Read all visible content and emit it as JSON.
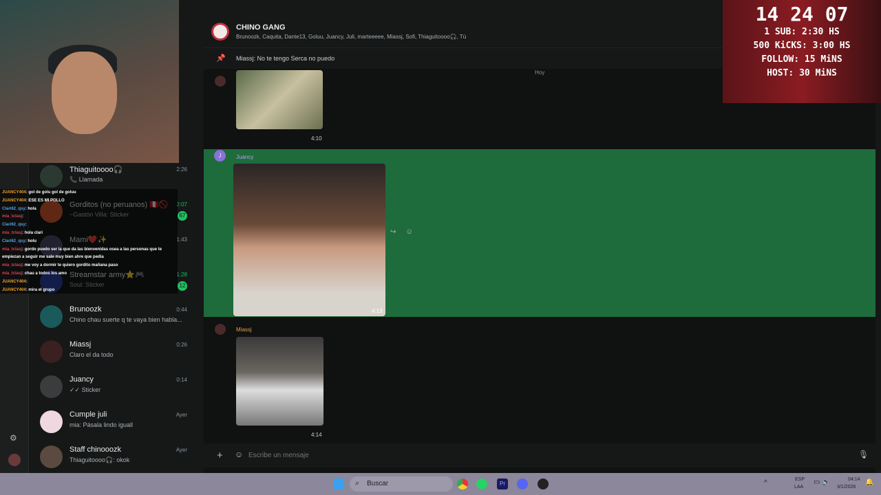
{
  "chat": {
    "name": "CHINO GANG",
    "members": "Brunoozk, Caquita, Dante13, Goluu, Juancy, Juli, marteeeee, Miassj, Sofi, Thiaguitoooo🎧, Tú",
    "pinned": "Miassj: No te tengo Serca no puedo",
    "day": "Hoy",
    "input_placeholder": "Escribe un mensaje"
  },
  "messages": [
    {
      "sender": "",
      "time": "4:10"
    },
    {
      "sender": "Juancy",
      "time": "4:13"
    },
    {
      "sender": "Miassj",
      "time": "4:14"
    }
  ],
  "chats": [
    {
      "name": "Thiaguitoooo🎧",
      "time": "2:26",
      "preview": "📞 Llamada"
    },
    {
      "name": "Gorditos (no peruanos) 🇵🇪🚫",
      "time": "2:07",
      "preview": "~Gastón Villa: Sticker",
      "badge": "67"
    },
    {
      "name": "Mami❤️✨",
      "time": "1:43",
      "preview": ""
    },
    {
      "name": "Streamstar army⭐🎮",
      "time": "1:28",
      "preview": "Soul: Sticker",
      "badge": "12"
    },
    {
      "name": "Brunoozk",
      "time": "0:44",
      "preview": "Chino chau suerte q te vaya bien habla..."
    },
    {
      "name": "Miassj",
      "time": "0:26",
      "preview": "Claro el da todo"
    },
    {
      "name": "Juancy",
      "time": "0:14",
      "preview": "✓✓ Sticker"
    },
    {
      "name": "Cumple juli",
      "time": "Ayer",
      "preview": "mia: Pásala lindo iguall"
    },
    {
      "name": "Staff chinooozk",
      "time": "Ayer",
      "preview": "Thiaguitoooo🎧: okok"
    }
  ],
  "stream_chat": [
    {
      "user": "JUANCY404",
      "msg": "gol de golu gol de goluu",
      "c": "u1"
    },
    {
      "user": "JUANCY404",
      "msg": "ESE ES MI POLLO",
      "c": "u1"
    },
    {
      "user": "Clari62_qsy",
      "msg": "hola",
      "c": "u2"
    },
    {
      "user": "mia_tclasj",
      "msg": "",
      "c": "u3"
    },
    {
      "user": "Clari62_qsy",
      "msg": "",
      "c": "u2"
    },
    {
      "user": "mia_tclasj",
      "msg": "hola clari",
      "c": "u3"
    },
    {
      "user": "Clari62_qsy",
      "msg": "holu",
      "c": "u2"
    },
    {
      "user": "mia_tclasj",
      "msg": "gordo puedo ser la que da las bienvenidas osea a las personas que te",
      "c": "u3"
    },
    {
      "user": "",
      "msg": "empiezan a seguir me sale muy bien ahre que pedia",
      "c": "u3"
    },
    {
      "user": "mia_tclasj",
      "msg": "me voy a dormir te quiero gordito mañana paso",
      "c": "u3"
    },
    {
      "user": "mia_tclasj",
      "msg": "chau a todos los amo",
      "c": "u3"
    },
    {
      "user": "JUANCY404",
      "msg": "",
      "c": "u1"
    },
    {
      "user": "JUANCY404",
      "msg": "mira el grupo",
      "c": "u1"
    }
  ],
  "overlay": {
    "timer": "14 24 07",
    "lines": [
      "1 SUB: 2:30 HS",
      "500 KiCKS: 3:00 HS",
      "FOLLOW: 15 MiNS",
      "HOST: 30 MiNS"
    ]
  },
  "taskbar": {
    "search": "Buscar",
    "lang1": "ESP",
    "lang2": "LAA",
    "time": "04:14",
    "date": "3/1/2026"
  },
  "colors": {
    "highlight": "#1e6b3c",
    "accent": "#21c063"
  }
}
